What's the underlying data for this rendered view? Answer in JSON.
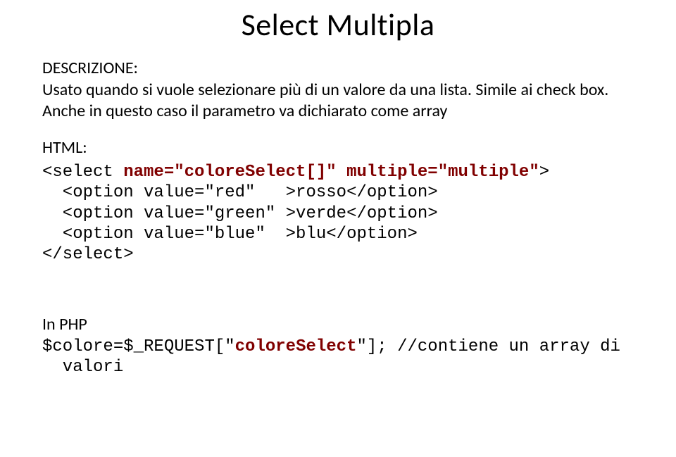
{
  "title": "Select Multipla",
  "desc_label": "DESCRIZIONE:",
  "desc_text": "Usato quando si vuole selezionare più di un valore da una lista. Simile ai check box. Anche in questo caso il parametro va dichiarato come array",
  "html_label": "HTML:",
  "code": {
    "line1_a": "<select ",
    "line1_name": "name=\"coloreSelect[]\"",
    "line1_b": " ",
    "line1_mult": "multiple=\"multiple\"",
    "line1_c": ">",
    "line2": "  <option value=\"red\"   >rosso</option>",
    "line3": "  <option value=\"green\" >verde</option>",
    "line4": "  <option value=\"blue\"  >blu</option>",
    "line5": "</select>"
  },
  "php_label": "In PHP",
  "php": {
    "line1_a": "$colore=$_REQUEST[\"",
    "line1_kw": "coloreSelect",
    "line1_b": "\"]; //contiene un array di",
    "line2": "  valori"
  }
}
